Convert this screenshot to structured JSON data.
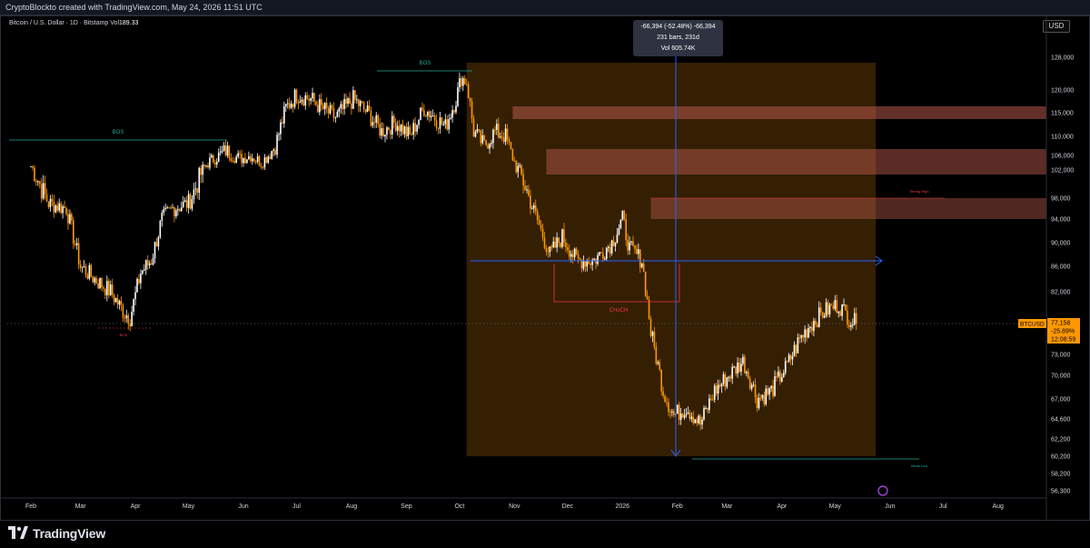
{
  "header": {
    "credit": "CryptoBlockto created with TradingView.com, May 24, 2026 11:51 UTC"
  },
  "symbol": {
    "name": "Bitcoin / U.S. Dollar · 1D · Bitstamp",
    "vol_label": "Vol",
    "vol_value": "189.33"
  },
  "currency_button": "USD",
  "measure_tooltip": {
    "line1": "-66,394 (-52.48%) -66,394",
    "line2": "231 bars, 231d",
    "line3": "Vol 605.74K"
  },
  "price_tag": {
    "symbol": "BTCUSD",
    "price": "77,158",
    "change": "-25.89%",
    "countdown": "12:08:59"
  },
  "footer": {
    "brand": "TradingView"
  },
  "colors": {
    "background": "#000000",
    "up_candle": "#ffffff",
    "down_candle": "#ff9800",
    "zone_fill": "#3d2503",
    "supply_zone": "#b4584a",
    "measure_line": "#2962ff",
    "bos_green": "#26a69a",
    "choch_red": "#f23645",
    "price_tag": "#ff9800"
  },
  "chart_data": {
    "type": "candlestick",
    "y_ticks": [
      "128,000",
      "120,000",
      "115,000",
      "110,000",
      "106,000",
      "102,000",
      "98,000",
      "94,000",
      "90,000",
      "86,000",
      "82,000",
      "77,158",
      "73,000",
      "70,000",
      "67,000",
      "64,600",
      "62,200",
      "60,200",
      "58,200",
      "56,300"
    ],
    "ylim": [
      56300,
      128000
    ],
    "x_ticks": [
      "Feb",
      "Mar",
      "Apr",
      "May",
      "Jun",
      "Jul",
      "Aug",
      "Sep",
      "Oct",
      "Nov",
      "Dec",
      "2026",
      "Feb",
      "Mar",
      "Apr",
      "May",
      "Jun",
      "Jul",
      "Aug"
    ],
    "x_tick_index": [
      0,
      28,
      59,
      89,
      120,
      150,
      181,
      212,
      242,
      273,
      303,
      334,
      365,
      393,
      424,
      454,
      485,
      515,
      546
    ],
    "annotations": [
      {
        "text": "BOS",
        "kind": "bos"
      },
      {
        "text": "BOS",
        "kind": "bos"
      },
      {
        "text": "CHoCH",
        "kind": "choch"
      },
      {
        "text": "BOS",
        "kind": "bos_red"
      },
      {
        "text": "Strong High",
        "kind": "label_red"
      },
      {
        "text": "Weak Low",
        "kind": "label_green"
      }
    ],
    "close_anchors": [
      [
        0,
        103000
      ],
      [
        10,
        97000
      ],
      [
        20,
        96000
      ],
      [
        28,
        86000
      ],
      [
        36,
        84000
      ],
      [
        45,
        82000
      ],
      [
        52,
        79000
      ],
      [
        56,
        78000
      ],
      [
        62,
        85000
      ],
      [
        68,
        87000
      ],
      [
        74,
        94000
      ],
      [
        80,
        96000
      ],
      [
        89,
        97000
      ],
      [
        100,
        104000
      ],
      [
        110,
        107000
      ],
      [
        118,
        105000
      ],
      [
        124,
        106000
      ],
      [
        130,
        104000
      ],
      [
        138,
        108000
      ],
      [
        144,
        116000
      ],
      [
        150,
        119000
      ],
      [
        158,
        118000
      ],
      [
        164,
        116000
      ],
      [
        172,
        114000
      ],
      [
        182,
        118000
      ],
      [
        190,
        115000
      ],
      [
        198,
        111000
      ],
      [
        206,
        113000
      ],
      [
        214,
        110000
      ],
      [
        222,
        116000
      ],
      [
        228,
        114000
      ],
      [
        234,
        112000
      ],
      [
        240,
        118000
      ],
      [
        243,
        123000
      ],
      [
        246,
        122000
      ],
      [
        250,
        111000
      ],
      [
        256,
        108000
      ],
      [
        262,
        111000
      ],
      [
        268,
        110000
      ],
      [
        274,
        103000
      ],
      [
        280,
        99000
      ],
      [
        288,
        92000
      ],
      [
        293,
        88000
      ],
      [
        300,
        91000
      ],
      [
        308,
        87000
      ],
      [
        318,
        87000
      ],
      [
        328,
        90000
      ],
      [
        334,
        94000
      ],
      [
        338,
        89000
      ],
      [
        345,
        87000
      ],
      [
        350,
        76000
      ],
      [
        357,
        68000
      ],
      [
        363,
        65000
      ],
      [
        370,
        66000
      ],
      [
        378,
        64000
      ],
      [
        386,
        68000
      ],
      [
        394,
        70000
      ],
      [
        402,
        72000
      ],
      [
        410,
        67000
      ],
      [
        418,
        68000
      ],
      [
        426,
        71000
      ],
      [
        434,
        75000
      ],
      [
        440,
        77000
      ],
      [
        448,
        79000
      ],
      [
        456,
        80000
      ],
      [
        462,
        78000
      ],
      [
        466,
        77158
      ]
    ]
  }
}
